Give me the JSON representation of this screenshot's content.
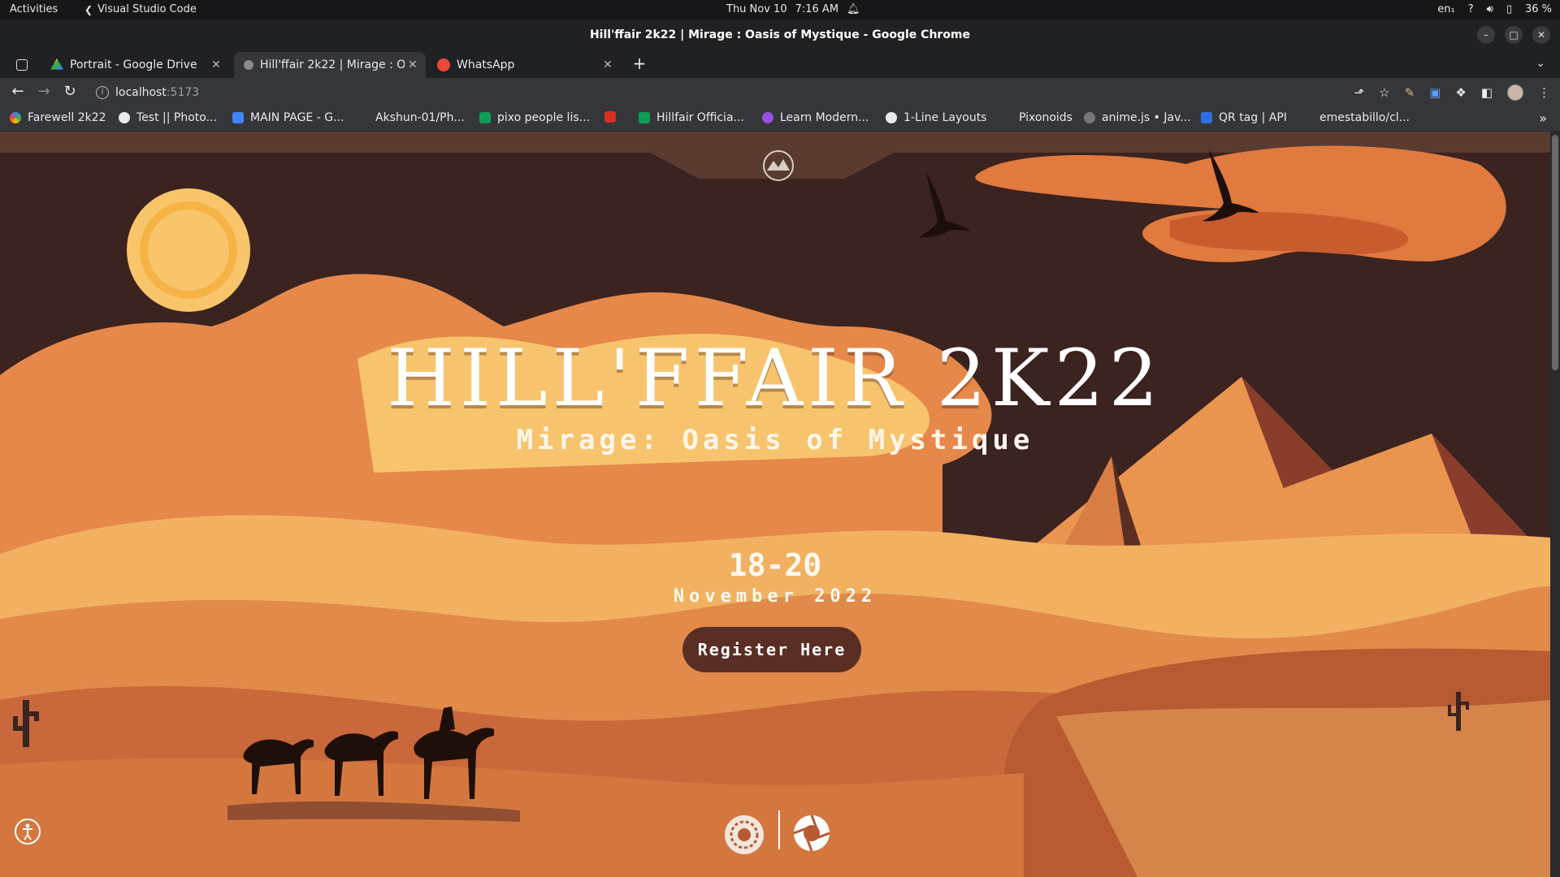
{
  "system_bar": {
    "activities": "Activities",
    "app_name": "Visual Studio Code",
    "date": "Thu Nov 10",
    "time": "7:16 AM",
    "lang": "en₁",
    "battery": "36 %"
  },
  "window": {
    "title": "Hill'ffair 2k22 | Mirage : Oasis of Mystique - Google Chrome"
  },
  "tabs": [
    {
      "label": "Portrait - Google Drive",
      "favicon": "google-drive-icon"
    },
    {
      "label": "Hill'ffair 2k22 | Mirage : O",
      "favicon": "hillfair-icon",
      "active": true
    },
    {
      "label": "WhatsApp",
      "favicon": "whatsapp-icon"
    }
  ],
  "address_bar": {
    "host": "localhost",
    "port": ":5173"
  },
  "bookmarks": [
    {
      "label": "Farewell 2k22"
    },
    {
      "label": "Test || Photo..."
    },
    {
      "label": "MAIN PAGE - G..."
    },
    {
      "label": "Akshun-01/Ph..."
    },
    {
      "label": "pixo people lis..."
    },
    {
      "label": ""
    },
    {
      "label": "Hillfair Officia..."
    },
    {
      "label": "Learn Modern..."
    },
    {
      "label": "1-Line Layouts"
    },
    {
      "label": "Pixonoids"
    },
    {
      "label": "anime.js • Jav..."
    },
    {
      "label": "QR tag | API"
    },
    {
      "label": "emestabillo/cl..."
    }
  ],
  "hero": {
    "title": "HILL'FFAIR 2K22",
    "subtitle": "Mirage: Oasis of Mystique",
    "dates": "18-20",
    "month": "November 2022",
    "register_label": "Register Here"
  },
  "colors": {
    "sky": "#3b231f",
    "dune_light": "#f7c46d",
    "dune_mid": "#e28a4a",
    "dune_dark": "#b85a32",
    "sun": "#f8c56a",
    "button": "#5a2e24"
  }
}
